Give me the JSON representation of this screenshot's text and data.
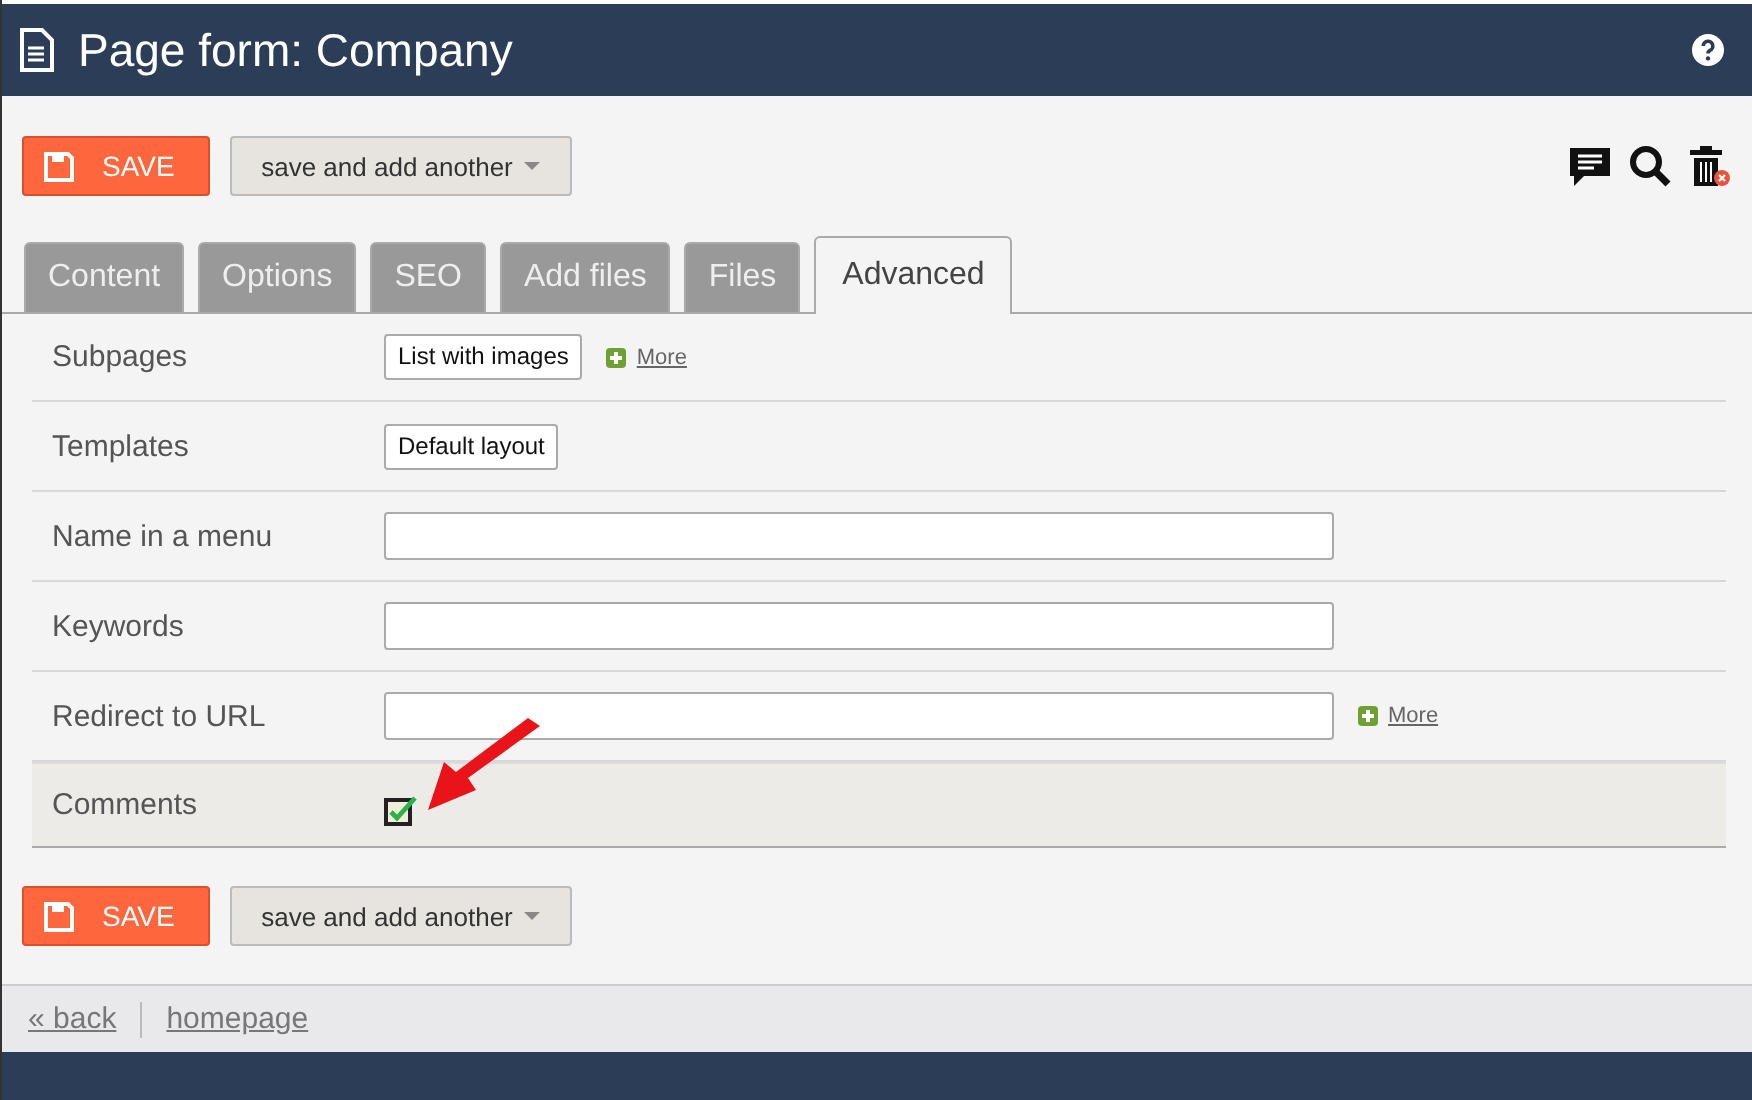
{
  "window": {
    "title": "Page form: Company"
  },
  "toolbar": {
    "save": "SAVE",
    "save_another": "save and add another"
  },
  "tabs": [
    {
      "label": "Content",
      "selected": false
    },
    {
      "label": "Options",
      "selected": false
    },
    {
      "label": "SEO",
      "selected": false
    },
    {
      "label": "Add files",
      "selected": false
    },
    {
      "label": "Files",
      "selected": false
    },
    {
      "label": "Advanced",
      "selected": true
    }
  ],
  "fields": [
    {
      "label": "Subpages",
      "kind": "select",
      "value": "List with images",
      "more": "More"
    },
    {
      "label": "Templates",
      "kind": "select",
      "value": "Default layout"
    },
    {
      "label": "Name in a menu",
      "kind": "text"
    },
    {
      "label": "Keywords",
      "kind": "text"
    },
    {
      "label": "Redirect to URL",
      "kind": "text",
      "more": "More"
    },
    {
      "label": "Comments",
      "kind": "checkbox",
      "checked": true
    }
  ],
  "bottom_bar": {
    "save": "SAVE",
    "save_another": "save and add another"
  },
  "nav": {
    "back": "« back",
    "home": "homepage"
  }
}
